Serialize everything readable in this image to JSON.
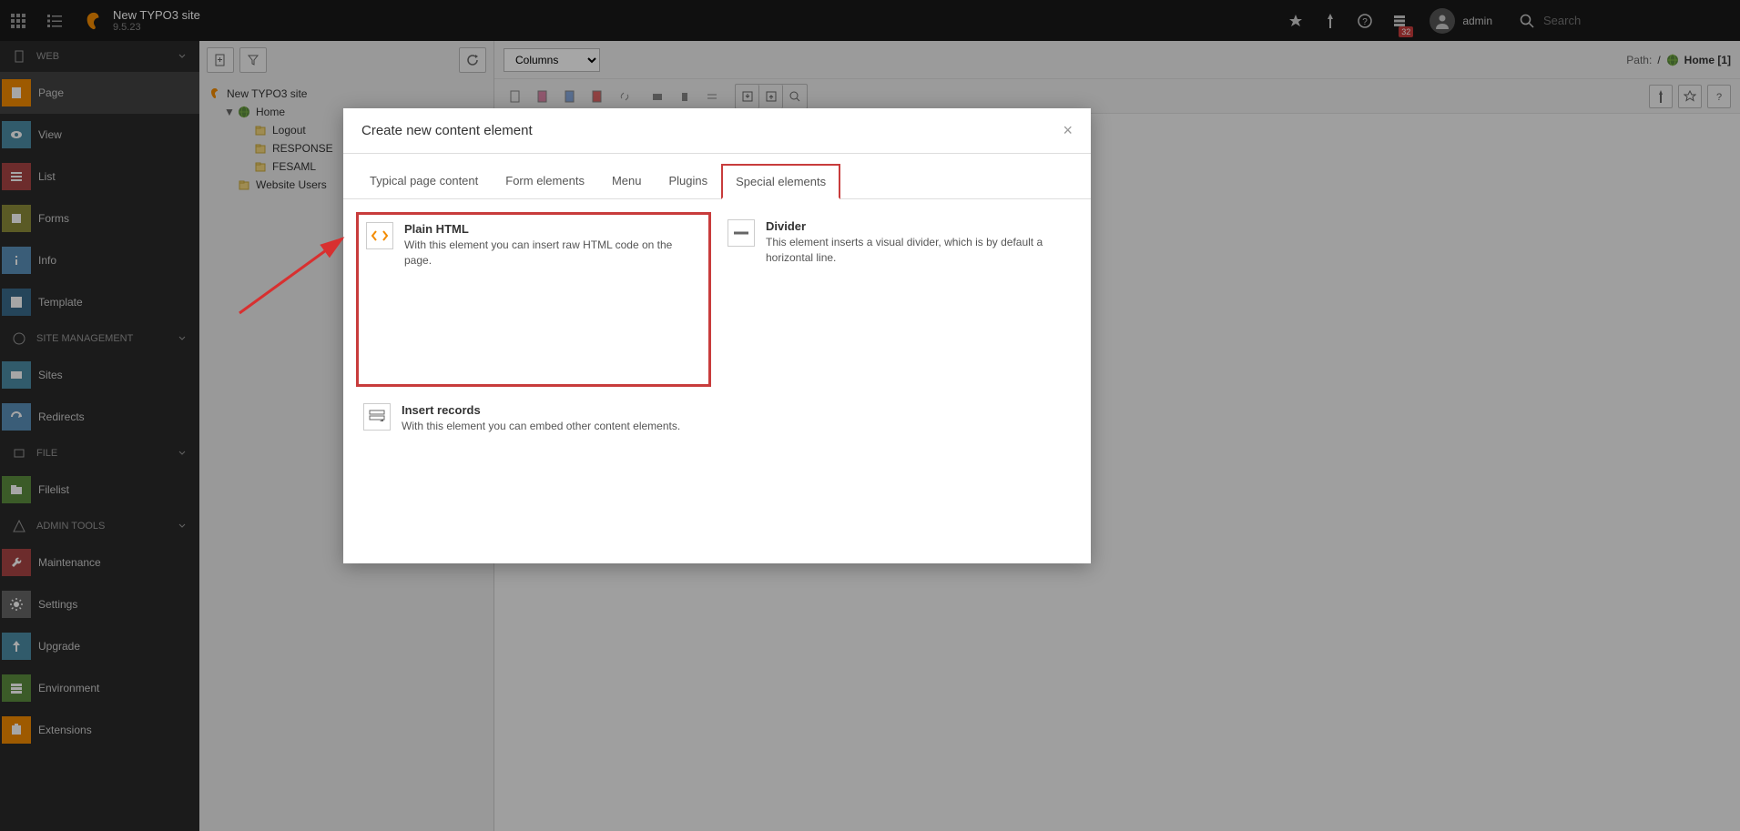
{
  "topbar": {
    "site_title": "New TYPO3 site",
    "version": "9.5.23",
    "badge": "32",
    "username": "admin",
    "search_placeholder": "Search"
  },
  "sidebar": {
    "sections": [
      {
        "label": "WEB",
        "items": [
          {
            "label": "Page",
            "icon": "page",
            "color": "ic-orange",
            "active": true
          },
          {
            "label": "View",
            "icon": "view",
            "color": "ic-teal"
          },
          {
            "label": "List",
            "icon": "list",
            "color": "ic-red"
          },
          {
            "label": "Forms",
            "icon": "forms",
            "color": "ic-olive"
          },
          {
            "label": "Info",
            "icon": "info",
            "color": "ic-blue"
          },
          {
            "label": "Template",
            "icon": "template",
            "color": "ic-darkblue"
          }
        ]
      },
      {
        "label": "SITE MANAGEMENT",
        "items": [
          {
            "label": "Sites",
            "icon": "sites",
            "color": "ic-teal"
          },
          {
            "label": "Redirects",
            "icon": "redirects",
            "color": "ic-blue"
          }
        ]
      },
      {
        "label": "FILE",
        "items": [
          {
            "label": "Filelist",
            "icon": "filelist",
            "color": "ic-green"
          }
        ]
      },
      {
        "label": "ADMIN TOOLS",
        "items": [
          {
            "label": "Maintenance",
            "icon": "maintenance",
            "color": "ic-red"
          },
          {
            "label": "Settings",
            "icon": "settings",
            "color": "ic-gray"
          },
          {
            "label": "Upgrade",
            "icon": "upgrade",
            "color": "ic-teal"
          },
          {
            "label": "Environment",
            "icon": "environment",
            "color": "ic-green"
          },
          {
            "label": "Extensions",
            "icon": "extensions",
            "color": "ic-orange"
          }
        ]
      }
    ]
  },
  "tree": {
    "root": "New TYPO3 site",
    "nodes": [
      {
        "label": "Home",
        "expanded": true,
        "globe": true,
        "children": [
          {
            "label": "Logout"
          },
          {
            "label": "RESPONSE"
          },
          {
            "label": "FESAML"
          }
        ]
      },
      {
        "label": "Website Users"
      }
    ]
  },
  "main": {
    "view_select": "Columns",
    "path_label": "Path:",
    "path_root": "/",
    "path_current": "Home [1]"
  },
  "modal": {
    "title": "Create new content element",
    "tabs": [
      {
        "label": "Typical page content"
      },
      {
        "label": "Form elements"
      },
      {
        "label": "Menu"
      },
      {
        "label": "Plugins"
      },
      {
        "label": "Special elements",
        "active": true
      }
    ],
    "elements": [
      {
        "title": "Plain HTML",
        "desc": "With this element you can insert raw HTML code on the page.",
        "highlight": true,
        "icon": "html"
      },
      {
        "title": "Divider",
        "desc": "This element inserts a visual divider, which is by default a horizontal line.",
        "icon": "divider"
      },
      {
        "title": "Insert records",
        "desc": "With this element you can embed other content elements.",
        "icon": "records"
      }
    ]
  }
}
